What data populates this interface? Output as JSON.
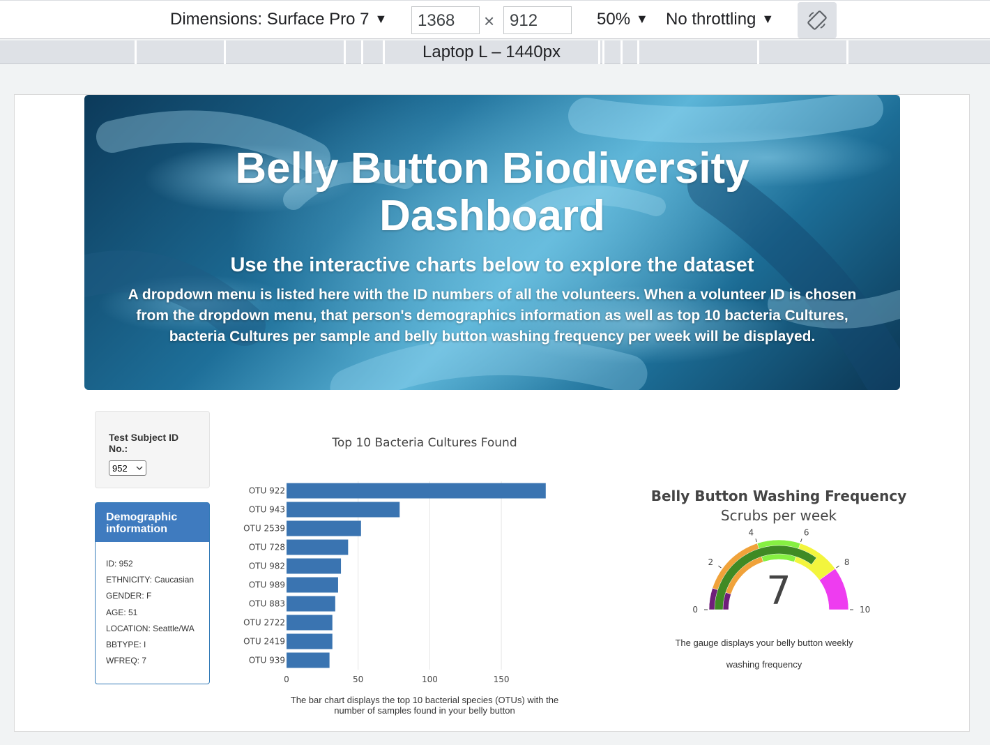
{
  "devtools": {
    "dimensions_label": "Dimensions: Surface Pro 7",
    "width": "1368",
    "height": "912",
    "zoom": "50%",
    "throttling": "No throttling",
    "caret": "▼",
    "times": "×",
    "breakpoint_label": "Laptop L – 1440px"
  },
  "hero": {
    "title_line1": "Belly Button Biodiversity",
    "title_line2": "Dashboard",
    "subtitle": "Use the interactive charts below to explore the dataset",
    "description": "A dropdown menu is listed here with the ID numbers of all the volunteers. When a volunteer ID is chosen from the dropdown menu, that person's demographics information as well as top 10 bacteria Cultures, bacteria Cultures per sample and belly button washing frequency per week will be displayed."
  },
  "selector": {
    "label": "Test Subject ID No.:",
    "value": "952"
  },
  "demographics": {
    "title": "Demographic information",
    "rows": [
      "ID: 952",
      "ETHNICITY: Caucasian",
      "GENDER: F",
      "AGE: 51",
      "LOCATION: Seattle/WA",
      "BBTYPE: I",
      "WFREQ: 7"
    ]
  },
  "chart_data": [
    {
      "type": "bar",
      "orientation": "horizontal",
      "title": "Top 10 Bacteria Cultures Found",
      "categories": [
        "OTU 922",
        "OTU 943",
        "OTU 2539",
        "OTU 728",
        "OTU 982",
        "OTU 989",
        "OTU 883",
        "OTU 2722",
        "OTU 2419",
        "OTU 939"
      ],
      "values": [
        181,
        79,
        52,
        43,
        38,
        36,
        34,
        32,
        32,
        30
      ],
      "xlim": [
        0,
        185
      ],
      "xticks": [
        0,
        50,
        100,
        150
      ],
      "grid": true,
      "bar_color": "#3a74b1"
    },
    {
      "type": "gauge",
      "title": "Belly Button Washing Frequency",
      "subtitle": "Scrubs per week",
      "value": 7,
      "range": [
        0,
        10
      ],
      "ticks": [
        0,
        2,
        4,
        6,
        8,
        10
      ],
      "steps": [
        {
          "range": [
            0,
            1
          ],
          "color": "#6f1e7a"
        },
        {
          "range": [
            1,
            4
          ],
          "color": "#f0a23a"
        },
        {
          "range": [
            4,
            6
          ],
          "color": "#86f042"
        },
        {
          "range": [
            6,
            8
          ],
          "color": "#f3f53d"
        },
        {
          "range": [
            8,
            10
          ],
          "color": "#ee3cf0"
        }
      ],
      "bar_color": "#3f8a24"
    }
  ],
  "captions": {
    "bar": "The bar chart displays the top 10 bacterial species (OTUs) with the number of samples found in your belly button",
    "gauge": "The gauge displays your belly button weekly washing frequency"
  }
}
